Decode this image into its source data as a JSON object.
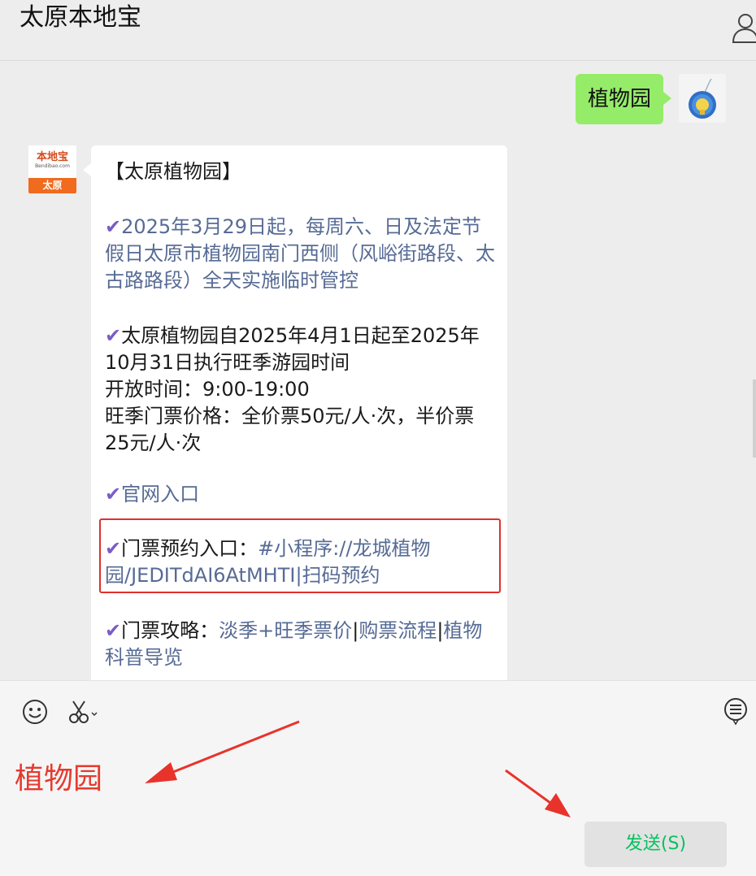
{
  "header": {
    "title": "太原本地宝",
    "profile_icon": "user-icon"
  },
  "chat": {
    "sent": {
      "text": "植物园",
      "avatar_icon": "blue-flower-avatar"
    },
    "received": {
      "avatar": {
        "name": "本地宝",
        "url": "Bendibao.com",
        "city": "太原"
      },
      "title": "【太原植物园】",
      "check_icon": "✔",
      "item1": "2025年3月29日起，每周六、日及法定节假日太原市植物园南门西侧（风峪街路段、太古路路段）全天实施临时管控",
      "item2_line1": "太原植物园自2025年4月1日起至2025年10月31日执行旺季游园时间",
      "item2_line2": "开放时间：9:00-19:00",
      "item2_line3": "旺季门票价格：全价票50元/人·次，半价票25元/人·次",
      "item3": "官网入口",
      "item4_label": "门票预约入口：",
      "item4_link": "#小程序://龙城植物园/JEDITdAI6AtMHTI|扫码预约",
      "item5_label": "门票攻略：",
      "item5_link1": "淡季+旺季票价",
      "item5_sep1": "|",
      "item5_link2": "购票流程",
      "item5_sep2": "|",
      "item5_link3": "植物科普导览"
    }
  },
  "toolbar": {
    "emoji_icon": "smiley-icon",
    "scissors_icon": "scissors-icon",
    "history_icon": "chat-history-icon"
  },
  "input": {
    "value": "植物园"
  },
  "send_button": {
    "label": "发送(S)"
  },
  "colors": {
    "sent_bubble": "#95ec69",
    "link": "#576b95",
    "check": "#7a5cc7",
    "highlight": "#e0302c",
    "send_text": "#07c160"
  }
}
